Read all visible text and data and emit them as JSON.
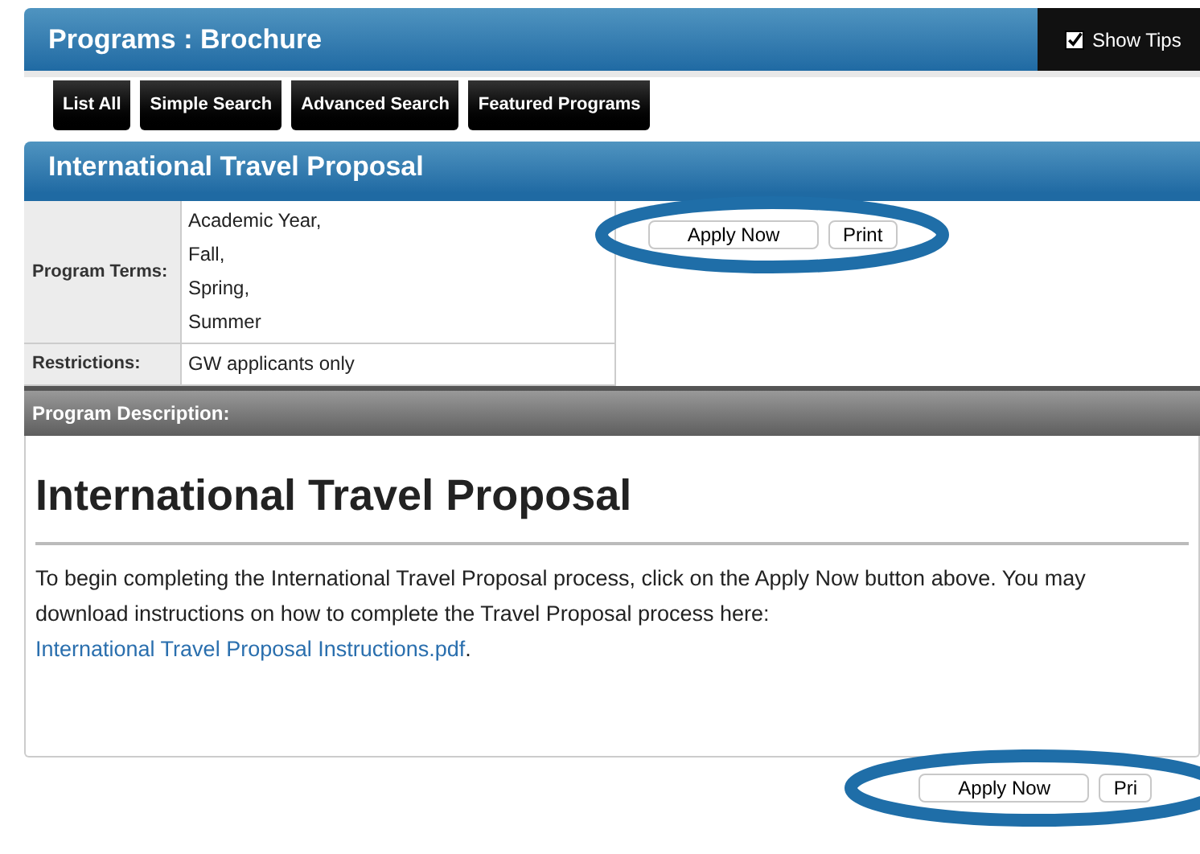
{
  "header": {
    "title": "Programs : Brochure",
    "show_tips": {
      "label": "Show Tips",
      "checked": true
    }
  },
  "nav_buttons": [
    "List All",
    "Simple Search",
    "Advanced Search",
    "Featured Programs"
  ],
  "section_title": "International Travel Proposal",
  "details": [
    {
      "label": "Program Terms:",
      "values": [
        "Academic Year,",
        "Fall,",
        "Spring,",
        "Summer"
      ]
    },
    {
      "label": "Restrictions:",
      "values": [
        "GW applicants only"
      ]
    }
  ],
  "top_actions": {
    "circled": true,
    "buttons": [
      "Apply Now",
      "Print"
    ]
  },
  "description": {
    "header": "Program Description:",
    "heading": "International Travel Proposal",
    "paragraph": "To begin completing the International Travel Proposal process, click on the Apply Now button above. You may download instructions on how to complete the Travel Proposal process here:",
    "link": "International Travel Proposal Instructions.pdf",
    "after_link": "."
  },
  "bottom_actions": {
    "circled": true,
    "buttons": [
      "Apply Now",
      "Pri"
    ]
  }
}
